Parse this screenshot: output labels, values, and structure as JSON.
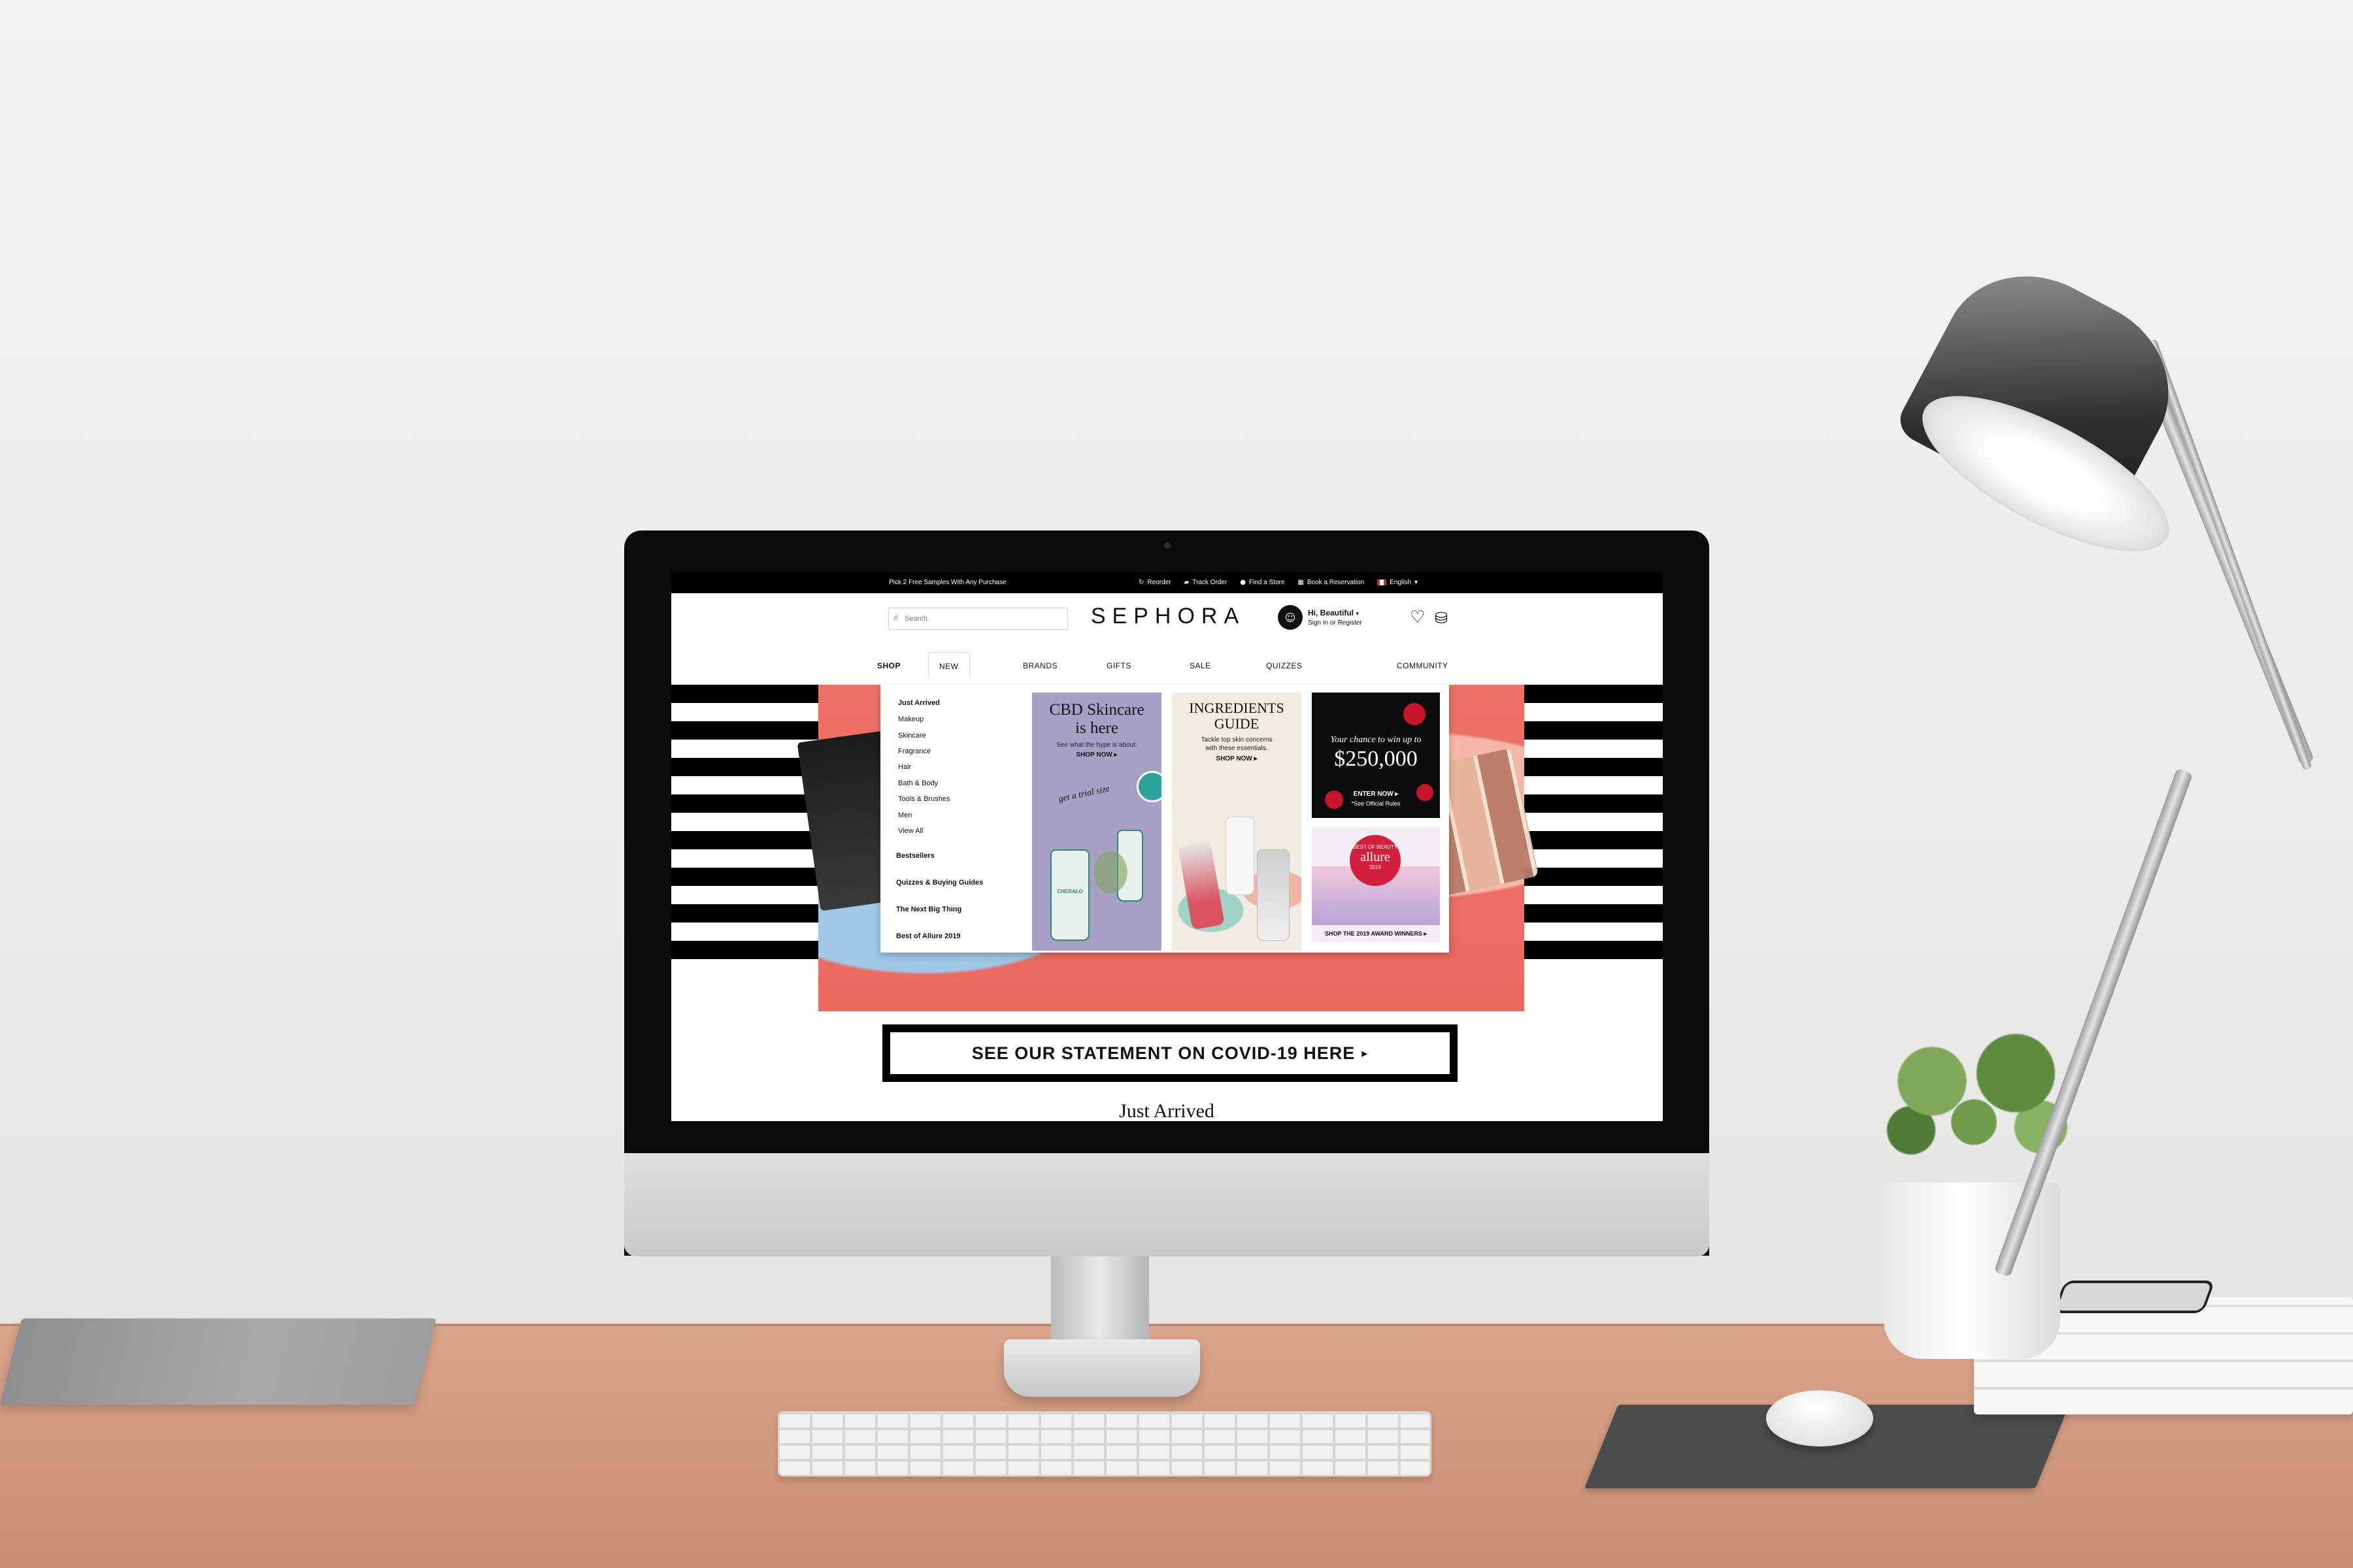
{
  "top_bar": {
    "promo": "Pick 2 Free Samples With Any Purchase",
    "links": [
      {
        "label": "Reorder",
        "icon": "refresh-icon"
      },
      {
        "label": "Track Order",
        "icon": "truck-icon"
      },
      {
        "label": "Find a Store",
        "icon": "pin-icon"
      },
      {
        "label": "Book a Reservation",
        "icon": "calendar-icon"
      }
    ],
    "language": "English"
  },
  "header": {
    "search_placeholder": "Search",
    "logo": "SEPHORA",
    "greeting": "Hi, Beautiful",
    "sign_in": "Sign In or Register"
  },
  "nav": {
    "items": [
      "SHOP",
      "NEW",
      "BRANDS",
      "GIFTS",
      "SALE",
      "QUIZZES",
      "COMMUNITY"
    ]
  },
  "dropdown": {
    "just_arrived": "Just Arrived",
    "sub_items": [
      "Makeup",
      "Skincare",
      "Fragrance",
      "Hair",
      "Bath & Body",
      "Tools & Brushes",
      "Men",
      "View All"
    ],
    "sections": [
      "Bestsellers",
      "Quizzes & Buying Guides",
      "The Next Big Thing",
      "Best of Allure 2019"
    ],
    "cards": {
      "cbd": {
        "title_line1": "CBD Skincare",
        "title_line2": "is here",
        "sub": "See what the hype is about.",
        "cta": "SHOP NOW ▸",
        "script": "get a trial size",
        "bottle_brand": "CHERALO"
      },
      "ingredients": {
        "title_line1": "INGREDIENTS",
        "title_line2": "GUIDE",
        "sub_line1": "Tackle top skin concerns",
        "sub_line2": "with these essentials.",
        "cta": "SHOP NOW ▸"
      },
      "win": {
        "line1": "Your chance to win up to",
        "amount": "$250,000",
        "cta": "ENTER NOW ▸",
        "rules": "*See Official Rules"
      },
      "allure": {
        "brand": "allure",
        "badge": "BEST OF BEAUTY",
        "year": "2019",
        "cta": "SHOP THE 2019 AWARD WINNERS ▸"
      }
    }
  },
  "covid_banner": {
    "label": "SEE OUR STATEMENT ON COVID-19 HERE",
    "arrow": "▸"
  },
  "section_heading": "Just Arrived",
  "colors": {
    "black": "#000000",
    "coral": "#ea6a60",
    "lavender": "#a89fc7"
  }
}
